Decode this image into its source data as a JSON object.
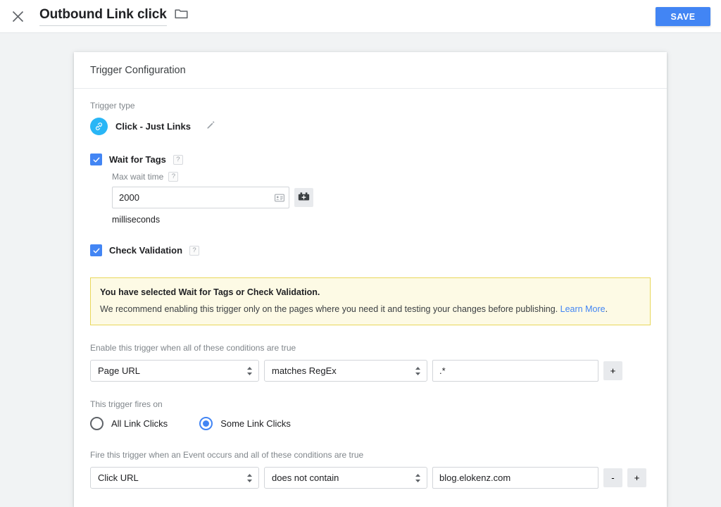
{
  "topbar": {
    "close_icon": "close-icon",
    "title": "Outbound Link click",
    "folder_icon": "folder-icon",
    "save_label": "SAVE"
  },
  "card": {
    "header_title": "Trigger Configuration",
    "trigger_type": {
      "label": "Trigger type",
      "icon": "link-icon",
      "name": "Click - Just Links",
      "edit_icon": "pencil-icon"
    },
    "wait_for_tags": {
      "label": "Wait for Tags",
      "checked": true,
      "help": "?",
      "max_wait_label": "Max wait time",
      "max_wait_help": "?",
      "max_wait_value": "2000",
      "variable_icon": "variable-picker-icon",
      "variable_button_icon": "add-variable-icon",
      "unit": "milliseconds"
    },
    "check_validation": {
      "label": "Check Validation",
      "checked": true,
      "help": "?"
    },
    "warning": {
      "title": "You have selected Wait for Tags or Check Validation.",
      "body_before": "We recommend enabling this trigger only on the pages where you need it and testing your changes before publishing. ",
      "link": "Learn More",
      "body_after": "."
    },
    "enable_conditions": {
      "label": "Enable this trigger when all of these conditions are true",
      "variable": "Page URL",
      "operator": "matches RegEx",
      "value": ".*",
      "add_label": "+"
    },
    "fires_on": {
      "label": "This trigger fires on",
      "options": [
        {
          "label": "All Link Clicks",
          "selected": false
        },
        {
          "label": "Some Link Clicks",
          "selected": true
        }
      ]
    },
    "event_conditions": {
      "label": "Fire this trigger when an Event occurs and all of these conditions are true",
      "variable": "Click URL",
      "operator": "does not contain",
      "value": "blog.elokenz.com",
      "remove_label": "-",
      "add_label": "+"
    }
  },
  "colors": {
    "accent_blue": "#4285f4",
    "link_badge": "#29b6f6",
    "warning_bg": "#fdfae5",
    "warning_border": "#e8d75a",
    "page_bg": "#f1f3f4"
  }
}
